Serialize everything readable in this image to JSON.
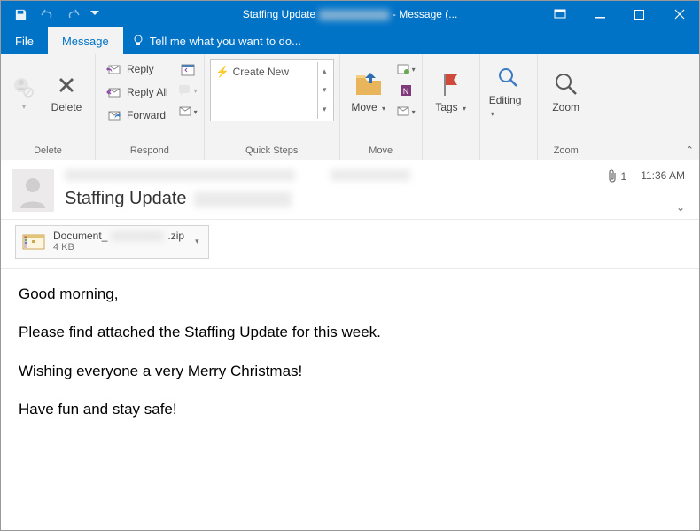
{
  "window": {
    "title_prefix": "Staffing Update",
    "title_suffix": "- Message (..."
  },
  "tabs": {
    "file": "File",
    "message": "Message",
    "tellme": "Tell me what you want to do..."
  },
  "ribbon": {
    "delete_group": "Delete",
    "delete": "Delete",
    "respond_group": "Respond",
    "reply": "Reply",
    "reply_all": "Reply All",
    "forward": "Forward",
    "quicksteps_group": "Quick Steps",
    "create_new": "Create New",
    "move_group": "Move",
    "move": "Move",
    "tags": "Tags",
    "editing": "Editing",
    "zoom_group": "Zoom",
    "zoom": "Zoom"
  },
  "header": {
    "subject": "Staffing Update",
    "time": "11:36 AM",
    "attachment_count": "1"
  },
  "attachment": {
    "name_prefix": "Document_",
    "ext": ".zip",
    "size": "4 KB"
  },
  "body": {
    "p1": "Good morning,",
    "p2": "Please find attached the Staffing Update for this week.",
    "p3": "Wishing everyone a very Merry Christmas!",
    "p4": "Have fun and stay safe!"
  }
}
